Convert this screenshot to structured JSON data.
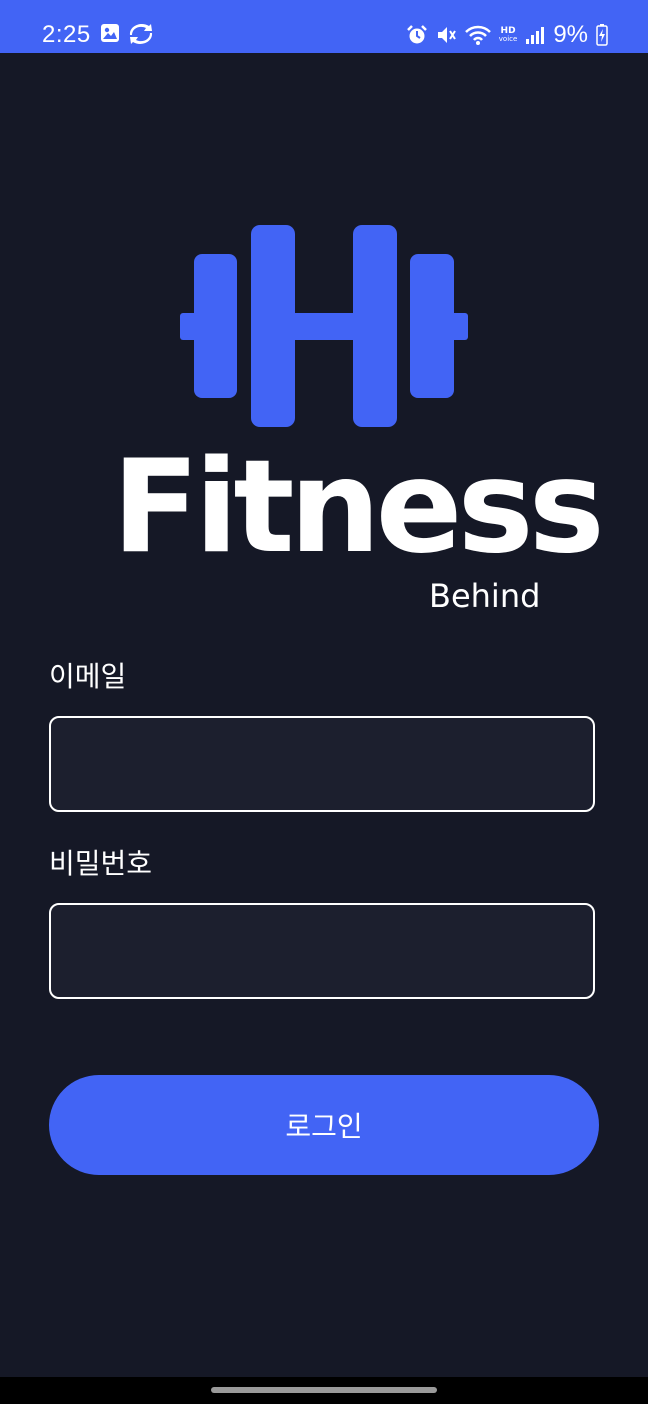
{
  "status_bar": {
    "time": "2:25",
    "battery": "9%",
    "hd_line1": "HD",
    "hd_line2": "voice",
    "icons": [
      "gallery-icon",
      "sync-icon",
      "alarm-icon",
      "mute-icon",
      "wifi-icon",
      "hd-voice-icon",
      "signal-icon",
      "battery-charging-icon"
    ],
    "background": "#4264f5"
  },
  "brand": {
    "name": "Fitness",
    "subtitle": "Behind",
    "logo_icon": "dumbbell-icon",
    "accent": "#4264f5"
  },
  "form": {
    "email_label": "이메일",
    "email_value": "",
    "password_label": "비밀번호",
    "password_value": "",
    "login_label": "로그인"
  },
  "theme": {
    "background": "#151826",
    "input_background": "#1c1f2e"
  }
}
